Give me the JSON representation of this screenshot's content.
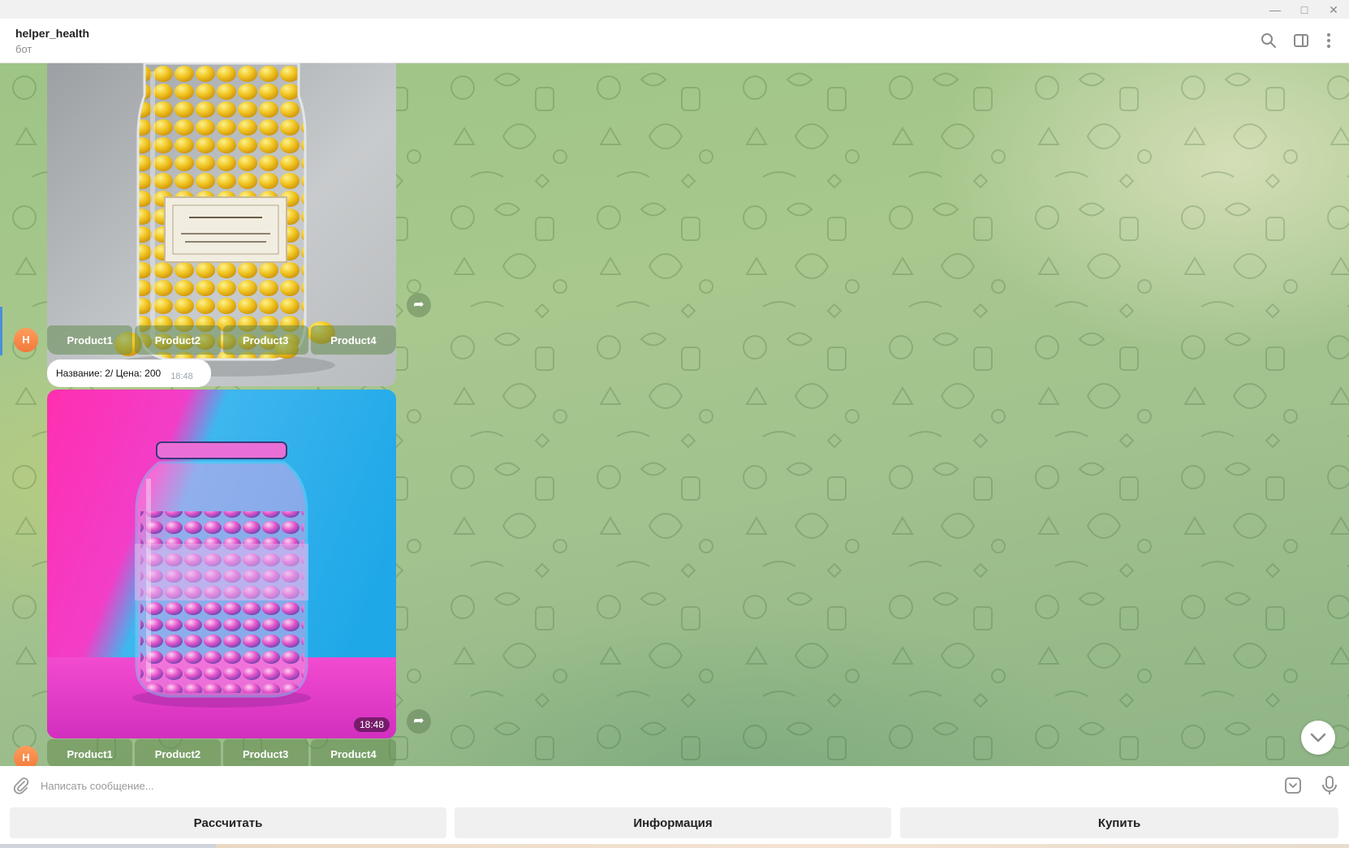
{
  "window": {
    "minimize_icon": "minimize-icon",
    "maximize_icon": "maximize-icon",
    "close_icon": "close-icon"
  },
  "header": {
    "chat_name": "helper_health",
    "chat_status": "бот",
    "icons": [
      "search-icon",
      "sidebar-toggle-icon",
      "more-vertical-icon"
    ]
  },
  "messages": [
    {
      "type": "photo",
      "image": "yellow-candy-jar",
      "avatar_letter": "H",
      "inline_keyboard": [
        "Product1",
        "Product2",
        "Product3",
        "Product4"
      ]
    },
    {
      "type": "text",
      "text": "Название: 2/ Цена: 200",
      "time": "18:48"
    },
    {
      "type": "photo",
      "image": "pink-blue-candy-jar",
      "time": "18:48",
      "avatar_letter": "H",
      "inline_keyboard": [
        "Product1",
        "Product2",
        "Product3",
        "Product4"
      ]
    }
  ],
  "composer": {
    "placeholder": "Написать сообщение...",
    "value": ""
  },
  "reply_keyboard": [
    "Рассчитать",
    "Информация",
    "Купить"
  ],
  "colors": {
    "avatar": "#f2793b",
    "chat_background": "#a8c88e",
    "inline_button": "#7d9d63"
  }
}
